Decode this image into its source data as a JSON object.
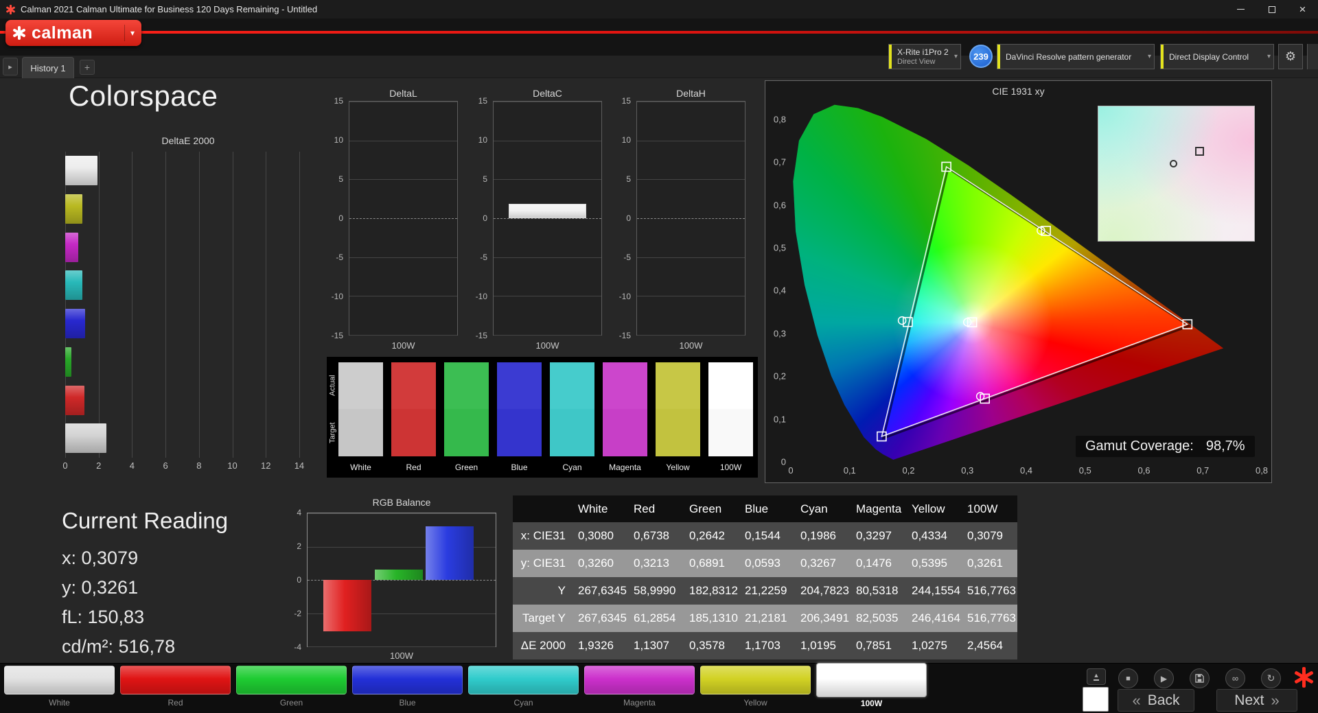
{
  "window": {
    "title": "Calman 2021 Calman Ultimate for Business 120 Days Remaining - Untitled"
  },
  "brand": {
    "logo_text": "calman"
  },
  "icons": {
    "chevron_down": "▾",
    "collapse": "▸",
    "add": "+",
    "close": "×",
    "stop": "■",
    "play": "▶",
    "link": "∞",
    "refresh": "↻",
    "eject": "▲",
    "gear": "⚙"
  },
  "nav": {
    "tab": "History 1"
  },
  "toolbar": {
    "meter_line1": "X-Rite i1Pro 2",
    "meter_line2": "Direct View",
    "badge": "239",
    "pattern_generator": "DaVinci Resolve pattern generator",
    "display_control": "Direct Display Control"
  },
  "page": {
    "heading": "Colorspace"
  },
  "deltaE": {
    "title": "DeltaE 2000",
    "x_ticks": [
      "0",
      "2",
      "4",
      "6",
      "8",
      "10",
      "12",
      "14"
    ],
    "x_max": 14.7,
    "bars": [
      {
        "name": "White",
        "value": 1.9326,
        "color": "#ededed"
      },
      {
        "name": "Yellow",
        "value": 1.0275,
        "color": "#b9b921"
      },
      {
        "name": "Magenta",
        "value": 0.7851,
        "color": "#c428c4"
      },
      {
        "name": "Cyan",
        "value": 1.0195,
        "color": "#28b9b9"
      },
      {
        "name": "Blue",
        "value": 1.1703,
        "color": "#2828cf"
      },
      {
        "name": "Green",
        "value": 0.3578,
        "color": "#28a828"
      },
      {
        "name": "Red",
        "value": 1.1307,
        "color": "#cf2828"
      },
      {
        "name": "100W",
        "value": 2.4564,
        "color": "#d4d4d4"
      }
    ]
  },
  "mini_charts": {
    "y_ticks": [
      "15",
      "10",
      "5",
      "0",
      "-5",
      "-10",
      "-15"
    ],
    "y_range": 15,
    "x_label": "100W",
    "bar_color": "#f2f2f2",
    "charts": [
      {
        "title": "DeltaL",
        "value": 0
      },
      {
        "title": "DeltaC",
        "value": 1.85
      },
      {
        "title": "DeltaH",
        "value": 0
      }
    ]
  },
  "comparator": {
    "row_labels": [
      "Actual",
      "Target"
    ],
    "columns": [
      {
        "label": "White",
        "actual": "#cdcdcd",
        "target": "#c6c6c6"
      },
      {
        "label": "Red",
        "actual": "#d23b3b",
        "target": "#cd3434"
      },
      {
        "label": "Green",
        "actual": "#3cbe53",
        "target": "#35b94c"
      },
      {
        "label": "Blue",
        "actual": "#3b3bd2",
        "target": "#3434cd"
      },
      {
        "label": "Cyan",
        "actual": "#46cccc",
        "target": "#3fc7c7"
      },
      {
        "label": "Magenta",
        "actual": "#cc46cc",
        "target": "#c73fc7"
      },
      {
        "label": "Yellow",
        "actual": "#c7c746",
        "target": "#c2c23f"
      },
      {
        "label": "100W",
        "actual": "#ffffff",
        "target": "#f9f9f9"
      }
    ]
  },
  "cie": {
    "title": "CIE 1931 xy",
    "x_ticks": [
      "0",
      "0,1",
      "0,2",
      "0,3",
      "0,4",
      "0,5",
      "0,6",
      "0,7",
      "0,8"
    ],
    "y_ticks": [
      "0",
      "0,1",
      "0,2",
      "0,3",
      "0,4",
      "0,5",
      "0,6",
      "0,7",
      "0,8"
    ],
    "x_max": 0.8,
    "y_max": 0.835,
    "gamut_label": "Gamut Coverage:",
    "gamut_value": "98,7%",
    "triangle": {
      "red": [
        0.6738,
        0.3213
      ],
      "green": [
        0.2642,
        0.6891
      ],
      "blue": [
        0.1544,
        0.0593
      ]
    },
    "targets": [
      [
        0.308,
        0.326
      ],
      [
        0.6738,
        0.3213
      ],
      [
        0.2642,
        0.6891
      ],
      [
        0.1544,
        0.0593
      ],
      [
        0.1986,
        0.3267
      ],
      [
        0.3297,
        0.1476
      ],
      [
        0.4334,
        0.5395
      ]
    ],
    "measured": [
      [
        0.3,
        0.3262
      ],
      [
        0.189,
        0.33
      ],
      [
        0.425,
        0.54
      ],
      [
        0.322,
        0.153
      ]
    ],
    "locus": [
      [
        0.1741,
        0.005
      ],
      [
        0.1566,
        0.0177
      ],
      [
        0.144,
        0.0297
      ],
      [
        0.1241,
        0.0578
      ],
      [
        0.0913,
        0.1327
      ],
      [
        0.0687,
        0.2007
      ],
      [
        0.0454,
        0.295
      ],
      [
        0.0235,
        0.4127
      ],
      [
        0.0082,
        0.5384
      ],
      [
        0.0039,
        0.6548
      ],
      [
        0.0139,
        0.7502
      ],
      [
        0.0389,
        0.812
      ],
      [
        0.0743,
        0.8338
      ],
      [
        0.1142,
        0.8262
      ],
      [
        0.1547,
        0.8059
      ],
      [
        0.2296,
        0.7543
      ],
      [
        0.3016,
        0.6923
      ],
      [
        0.3731,
        0.6245
      ],
      [
        0.4441,
        0.5547
      ],
      [
        0.5125,
        0.4866
      ],
      [
        0.5752,
        0.4242
      ],
      [
        0.627,
        0.3725
      ],
      [
        0.6658,
        0.334
      ],
      [
        0.6915,
        0.3083
      ],
      [
        0.7079,
        0.292
      ],
      [
        0.719,
        0.2809
      ],
      [
        0.7347,
        0.2653
      ]
    ]
  },
  "current_reading": {
    "title": "Current Reading",
    "lines": [
      "x: 0,3079",
      "y: 0,3261",
      "fL: 150,83",
      "cd/m²: 516,78"
    ]
  },
  "rgb_balance": {
    "title": "RGB Balance",
    "y_ticks": [
      "4",
      "2",
      "0",
      "-2",
      "-4"
    ],
    "y_range": 4,
    "x_label": "100W",
    "bars": [
      {
        "name": "red",
        "value": -3.1,
        "color": "#e02020"
      },
      {
        "name": "green",
        "value": 0.6,
        "color": "#28b428"
      },
      {
        "name": "blue",
        "value": 3.2,
        "color": "#2a3ce0"
      }
    ]
  },
  "table": {
    "headers": [
      "",
      "White",
      "Red",
      "Green",
      "Blue",
      "Cyan",
      "Magenta",
      "Yellow",
      "100W"
    ],
    "rows": [
      {
        "label": "x: CIE31",
        "values": [
          "0,3080",
          "0,6738",
          "0,2642",
          "0,1544",
          "0,1986",
          "0,3297",
          "0,4334",
          "0,3079"
        ]
      },
      {
        "label": "y: CIE31",
        "values": [
          "0,3260",
          "0,3213",
          "0,6891",
          "0,0593",
          "0,3267",
          "0,1476",
          "0,5395",
          "0,3261"
        ]
      },
      {
        "label": "Y",
        "values": [
          "267,6345",
          "58,9990",
          "182,8312",
          "21,2259",
          "204,7823",
          "80,5318",
          "244,1554",
          "516,7763"
        ]
      },
      {
        "label": "Target Y",
        "values": [
          "267,6345",
          "61,2854",
          "185,1310",
          "21,2181",
          "206,3491",
          "82,5035",
          "246,4164",
          "516,7763"
        ]
      },
      {
        "label": "ΔE 2000",
        "values": [
          "1,9326",
          "1,1307",
          "0,3578",
          "1,1703",
          "1,0195",
          "0,7851",
          "1,0275",
          "2,4564"
        ]
      }
    ]
  },
  "pattern_bar": {
    "items": [
      {
        "label": "White",
        "color": "#e2e2e2",
        "selected": false
      },
      {
        "label": "Red",
        "color": "#e01414",
        "selected": false
      },
      {
        "label": "Green",
        "color": "#1ecc32",
        "selected": false
      },
      {
        "label": "Blue",
        "color": "#2330d8",
        "selected": false
      },
      {
        "label": "Cyan",
        "color": "#30cccc",
        "selected": false
      },
      {
        "label": "Magenta",
        "color": "#cc30cc",
        "selected": false
      },
      {
        "label": "Yellow",
        "color": "#d2d224",
        "selected": false
      },
      {
        "label": "100W",
        "color": "#ffffff",
        "selected": true
      }
    ]
  },
  "transport": {
    "back": "Back",
    "next": "Next",
    "back_chevron": "«",
    "next_chevron": "»"
  }
}
